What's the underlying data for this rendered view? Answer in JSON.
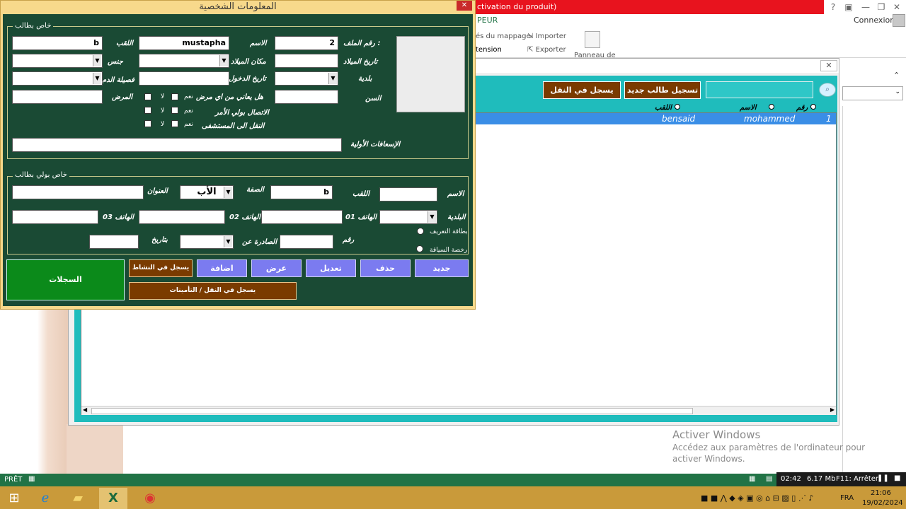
{
  "excel": {
    "red_bar_text": "ctivation du produit)",
    "ribbon_tab": "PEUR",
    "connexion": "Connexion",
    "ribbon_items": {
      "mappage": "és du mappage",
      "importer": "Importer",
      "extension": "tension",
      "exporter": "Exporter",
      "panneau": "Panneau de"
    },
    "status_left": "PRÊT",
    "status_time": "02:42",
    "status_mem": "6.17 Mb",
    "status_key": "F11: Arrêter",
    "activate_title": "Activer Windows",
    "activate_sub": "Accédez aux paramètres de l'ordinateur pour activer Windows."
  },
  "taskbar": {
    "lang": "FRA",
    "time": "21:06",
    "date": "19/02/2024"
  },
  "form2": {
    "buttons": {
      "new_student": "تسجيل طالب جديد",
      "register_transport": "يسجل في النقل"
    },
    "headers": {
      "number": "رقم",
      "name": "الاسم",
      "surname": "اللقب"
    },
    "row": {
      "number": "1",
      "name": "mohammed",
      "surname": "bensaid"
    }
  },
  "main_form": {
    "title": "المعلومات الشخصية",
    "close": "✕",
    "student_section": {
      "legend": "خاص بطالب",
      "file_no_label": "رقم الملف :",
      "file_no_value": "2",
      "name_label": "الاسم",
      "name_value": "mustapha",
      "surname_label": "اللقب",
      "surname_value": "b",
      "birth_date_label": "تاريخ الميلاد",
      "birth_place_label": "مكان الميلاد",
      "gender_label": "جنس",
      "municipality_label": "بلدية",
      "entry_date_label": "تاريخ الدخول",
      "blood_label": "فصيلة الدم",
      "age_label": "السن",
      "disease_q": "هل يعاني من اي مرض",
      "contact_parent": "الاتصال بولي الأمر",
      "transfer_hospital": "النقل الى المستشفى",
      "disease_label": "المرض",
      "yes": "نعم",
      "no": "لا",
      "first_aid_label": "الإسعافات الأولية"
    },
    "guardian_section": {
      "legend": "خاص بولي  بطالب",
      "name_label": "الاسم",
      "surname_label": "اللقب",
      "surname_value": "b",
      "relation_label": "الصفة",
      "relation_value": "الأب",
      "address_label": "العنوان",
      "municipality_label": "البلدية",
      "phone1_label": "الهاتف 01",
      "phone2_label": "الهاتف 02",
      "phone3_label": "الهاتف 03",
      "id_card_label": "بطاقة التعريف",
      "license_label": "رخصة السياقة",
      "number_label": "رقم",
      "issued_by_label": "الصادرة عن",
      "date_label": "بتاريخ"
    },
    "buttons": {
      "records": "السجلات",
      "activity": "يسجل في النشاط",
      "add": "اضافة",
      "view": "عرض",
      "edit": "تعديل",
      "delete": "حذف",
      "new": "جديد",
      "transport_insurance": "يسجل في النقل / التأمينات"
    }
  }
}
